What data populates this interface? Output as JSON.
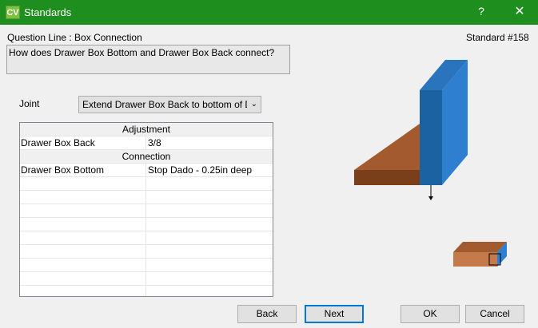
{
  "window": {
    "app_icon": "CV",
    "title": "Standards",
    "help": "?",
    "close": "✕"
  },
  "question_line_label": "Question Line : Box Connection",
  "standard_number": "Standard #158",
  "question_text": "How does Drawer Box Bottom and Drawer Box Back connect?",
  "joint": {
    "label": "Joint",
    "selected": "Extend Drawer Box Back to bottom of Drawer Box Bottom"
  },
  "grid": {
    "rows": [
      {
        "type": "header",
        "text": "Adjustment"
      },
      {
        "type": "data",
        "name": "Drawer Box Back",
        "value": "3/8"
      },
      {
        "type": "header",
        "text": "Connection"
      },
      {
        "type": "data",
        "name": "Drawer Box Bottom",
        "value": "Stop Dado - 0.25in deep"
      },
      {
        "type": "empty"
      },
      {
        "type": "empty"
      },
      {
        "type": "empty"
      },
      {
        "type": "empty"
      },
      {
        "type": "empty"
      },
      {
        "type": "empty"
      },
      {
        "type": "empty"
      },
      {
        "type": "empty"
      }
    ]
  },
  "buttons": {
    "back": "Back",
    "next": "Next",
    "ok": "OK",
    "cancel": "Cancel"
  },
  "colors": {
    "titlebar": "#1e8f1e",
    "back_panel_front": "#1b62a3",
    "back_panel_side": "#2f7fd0",
    "bottom_top": "#a35a2e",
    "bottom_front": "#7a3e1b"
  }
}
